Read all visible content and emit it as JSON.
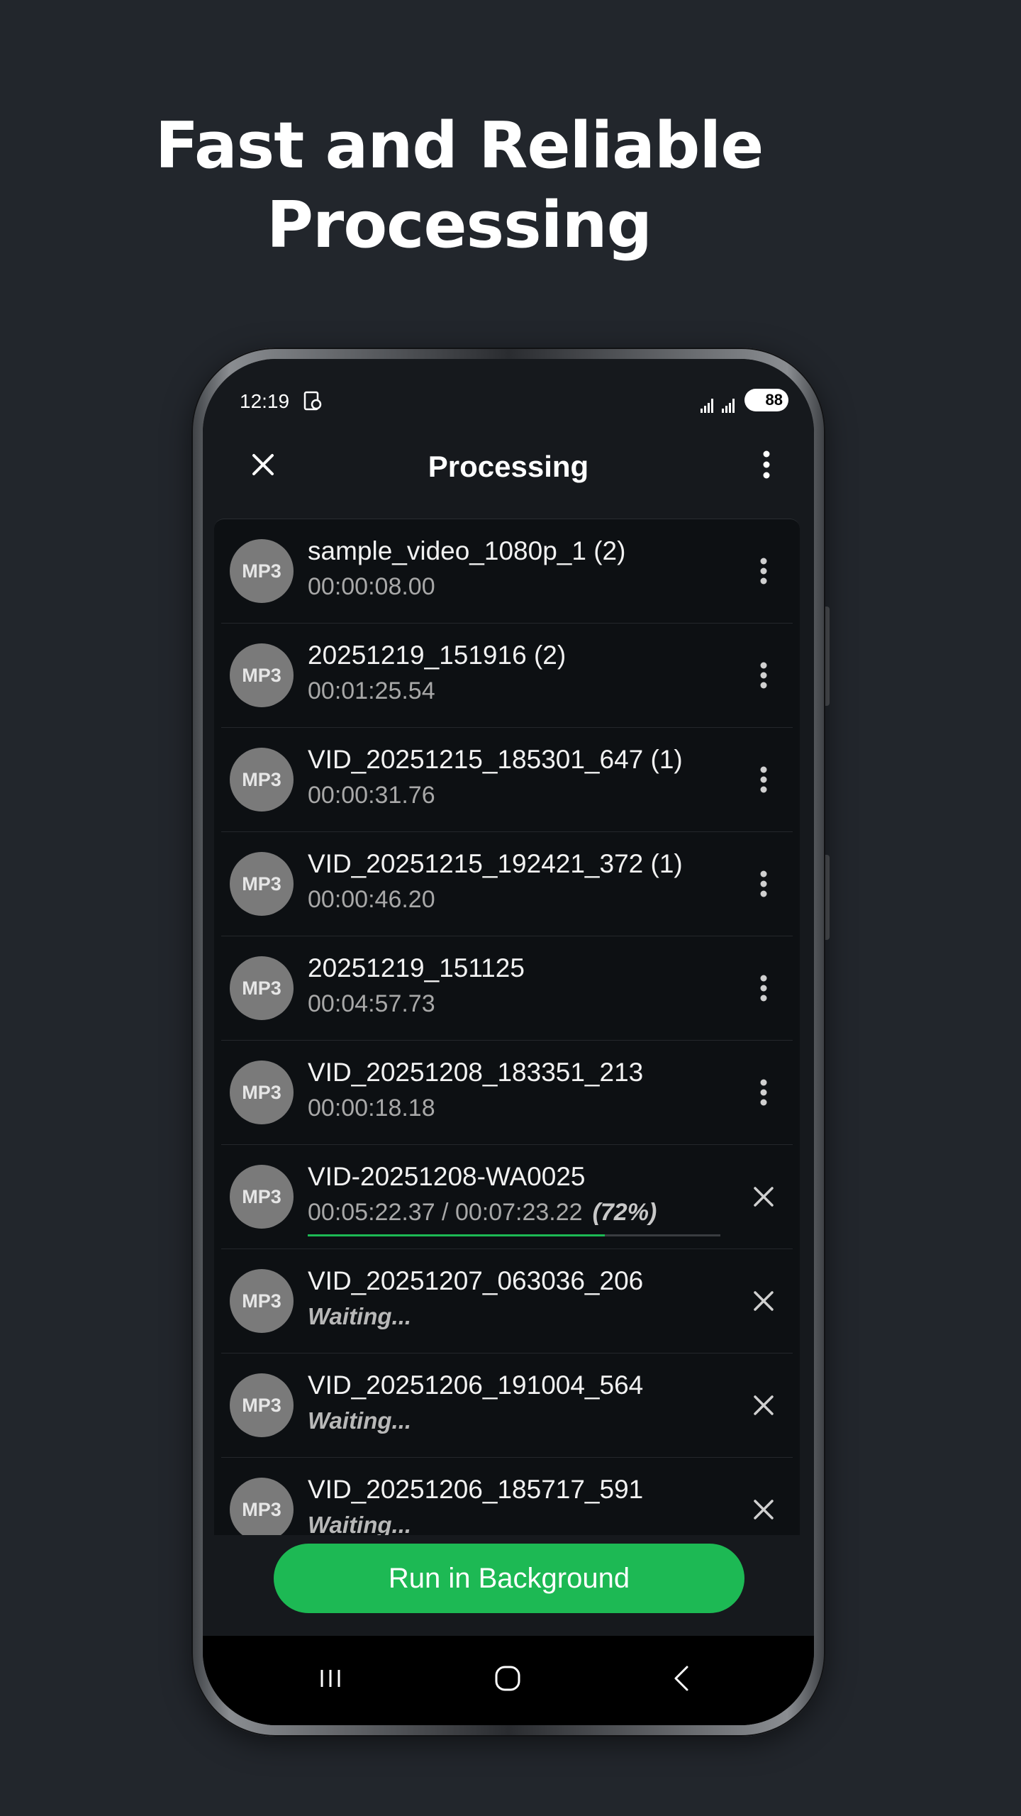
{
  "headline": {
    "line1": "Fast and Reliable",
    "line2": "Processing"
  },
  "status_bar": {
    "time": "12:19",
    "battery": "88"
  },
  "toolbar": {
    "title": "Processing"
  },
  "items": [
    {
      "badge": "MP3",
      "title": "sample_video_1080p_1 (2)",
      "subtitle": "00:00:08.00",
      "state": "done"
    },
    {
      "badge": "MP3",
      "title": "20251219_151916 (2)",
      "subtitle": "00:01:25.54",
      "state": "done"
    },
    {
      "badge": "MP3",
      "title": "VID_20251215_185301_647 (1)",
      "subtitle": "00:00:31.76",
      "state": "done"
    },
    {
      "badge": "MP3",
      "title": "VID_20251215_192421_372 (1)",
      "subtitle": "00:00:46.20",
      "state": "done"
    },
    {
      "badge": "MP3",
      "title": "20251219_151125",
      "subtitle": "00:04:57.73",
      "state": "done"
    },
    {
      "badge": "MP3",
      "title": "VID_20251208_183351_213",
      "subtitle": "00:00:18.18",
      "state": "done"
    },
    {
      "badge": "MP3",
      "title": "VID-20251208-WA0025",
      "subtitle": "00:05:22.37 / 00:07:23.22",
      "percent": "(72%)",
      "progress": 0.72,
      "state": "processing"
    },
    {
      "badge": "MP3",
      "title": "VID_20251207_063036_206",
      "subtitle": "Waiting...",
      "state": "waiting"
    },
    {
      "badge": "MP3",
      "title": "VID_20251206_191004_564",
      "subtitle": "Waiting...",
      "state": "waiting"
    },
    {
      "badge": "MP3",
      "title": "VID_20251206_185717_591",
      "subtitle": "Waiting...",
      "state": "waiting"
    }
  ],
  "actions": {
    "run_background": "Run in Background"
  },
  "colors": {
    "accent": "#1db954",
    "background": "#22262c"
  }
}
